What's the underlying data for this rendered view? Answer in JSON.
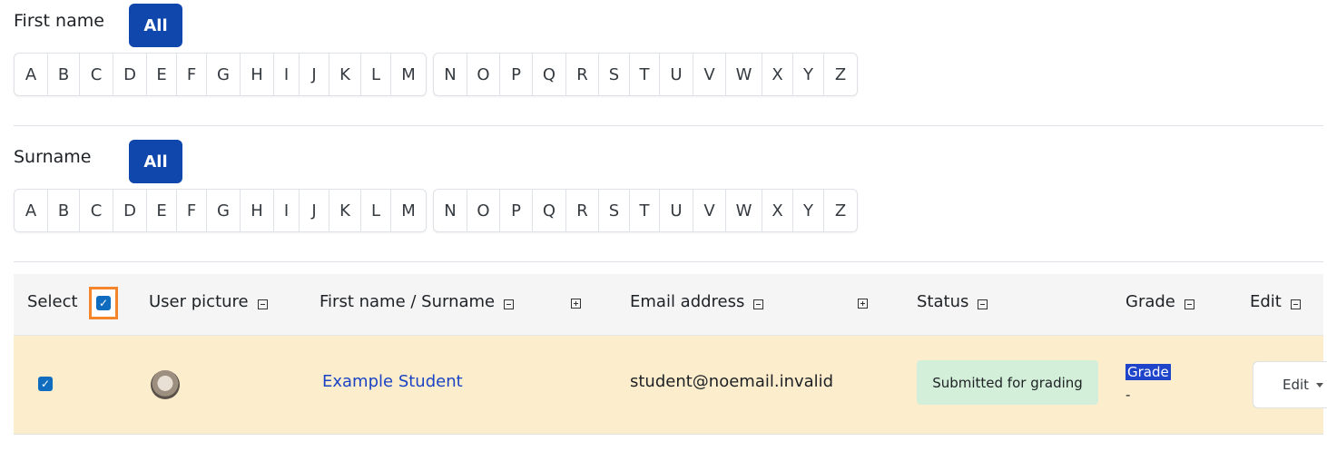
{
  "first_name_filter": {
    "label": "First name",
    "all_label": "All",
    "letters_a_m": [
      "A",
      "B",
      "C",
      "D",
      "E",
      "F",
      "G",
      "H",
      "I",
      "J",
      "K",
      "L",
      "M"
    ],
    "letters_n_z": [
      "N",
      "O",
      "P",
      "Q",
      "R",
      "S",
      "T",
      "U",
      "V",
      "W",
      "X",
      "Y",
      "Z"
    ]
  },
  "surname_filter": {
    "label": "Surname",
    "all_label": "All",
    "letters_a_m": [
      "A",
      "B",
      "C",
      "D",
      "E",
      "F",
      "G",
      "H",
      "I",
      "J",
      "K",
      "L",
      "M"
    ],
    "letters_n_z": [
      "N",
      "O",
      "P",
      "Q",
      "R",
      "S",
      "T",
      "U",
      "V",
      "W",
      "X",
      "Y",
      "Z"
    ]
  },
  "table": {
    "headers": {
      "select": "Select",
      "user_picture": "User picture",
      "name": "First name / Surname",
      "email": "Email address",
      "status": "Status",
      "grade": "Grade",
      "edit": "Edit"
    },
    "select_all_checked": true,
    "rows": [
      {
        "checked": true,
        "name": "Example Student",
        "email": "student@noemail.invalid",
        "status": "Submitted for grading",
        "grade_label": "Grade",
        "grade_value": "-",
        "edit_label": "Edit"
      }
    ]
  },
  "colors": {
    "primary": "#0f47ad",
    "row_highlight": "#fcedcd",
    "status_bg": "#d4efd9",
    "link": "#1a44c4",
    "select_highlight": "#f4852a"
  },
  "icons": {
    "collapse": "collapse-column-icon",
    "expand": "expand-column-icon",
    "check": "checkmark-icon",
    "caret": "caret-down-icon"
  }
}
